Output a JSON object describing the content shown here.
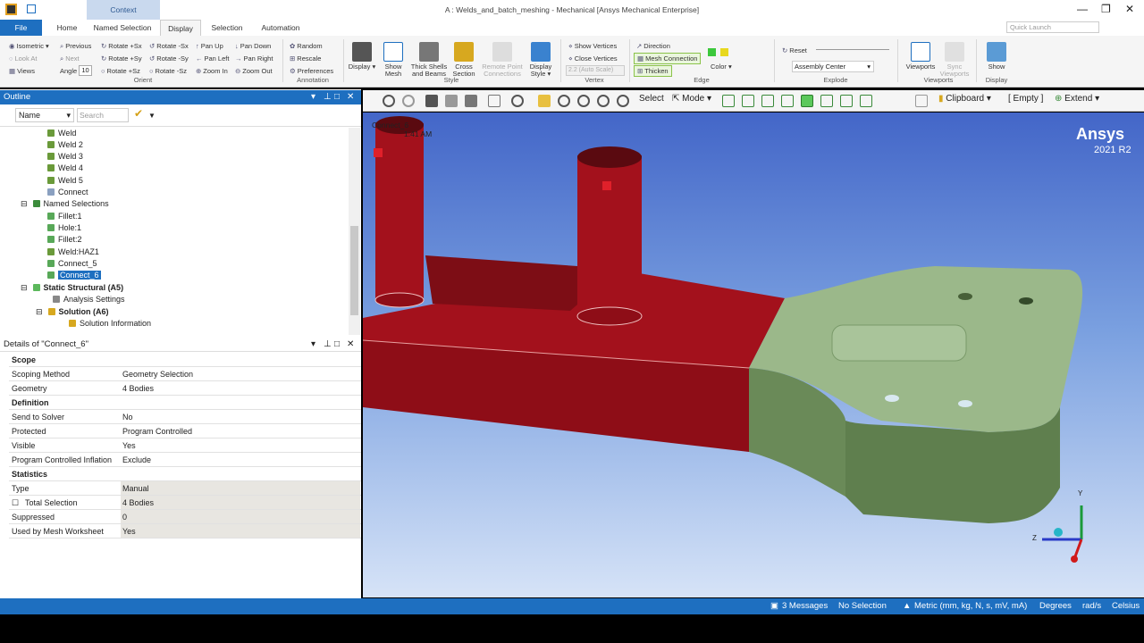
{
  "window": {
    "title": "A : Welds_and_batch_meshing - Mechanical [Ansys Mechanical Enterprise]",
    "context_label": "Context"
  },
  "tabs": [
    "File",
    "Home",
    "Named Selection",
    "Display",
    "Selection",
    "Automation"
  ],
  "quick_launch_placeholder": "Quick Launch",
  "ribbon": {
    "orient": {
      "items": [
        "Isometric",
        "Previous",
        "Rotate +Sx",
        "Rotate -Sx",
        "Pan Up",
        "Pan Down",
        "Look At",
        "Next",
        "Rotate +Sy",
        "Rotate -Sy",
        "Pan Left",
        "Pan Right",
        "Views",
        "Angle",
        "Rotate +Sz",
        "Rotate -Sz",
        "Zoom In",
        "Zoom Out"
      ],
      "angle_value": "10",
      "label": "Orient"
    },
    "annotation": {
      "items": [
        "Random",
        "Rescale",
        "Preferences"
      ],
      "label": "Annotation"
    },
    "style": {
      "items": [
        "Display",
        "Show Mesh",
        "Thick Shells and Beams",
        "Cross Section",
        "Remote Point Connections",
        "Display Style"
      ],
      "label": "Style"
    },
    "vertex": {
      "items": [
        "Show Vertices",
        "Close Vertices"
      ],
      "scale": "2.2 (Auto Scale)",
      "label": "Vertex"
    },
    "edge": {
      "items": [
        "Direction",
        "Mesh Connection",
        "Thicken",
        "Color"
      ],
      "label": "Edge"
    },
    "explode": {
      "reset": "Reset",
      "center": "Assembly Center",
      "label": "Explode"
    },
    "viewports": {
      "items": [
        "Viewports",
        "Sync Viewports"
      ],
      "label": "Viewports"
    },
    "display": {
      "items": [
        "Show"
      ],
      "label": "Display"
    }
  },
  "outline": {
    "title": "Outline",
    "filter_name": "Name",
    "search_placeholder": "Search Outline",
    "items": [
      "Weld",
      "Weld 2",
      "Weld 3",
      "Weld 4",
      "Weld 5",
      "Connect",
      "Named Selections",
      "Fillet:1",
      "Hole:1",
      "Fillet:2",
      "Weld:HAZ1",
      "Connect_5",
      "Connect_6",
      "Static Structural (A5)",
      "Analysis Settings",
      "Solution (A6)",
      "Solution Information"
    ]
  },
  "details": {
    "title": "Details of \"Connect_6\"",
    "rows": [
      {
        "k": "Scope",
        "v": ""
      },
      {
        "k": "Scoping Method",
        "v": "Geometry Selection"
      },
      {
        "k": "Geometry",
        "v": "4 Bodies"
      },
      {
        "k": "Definition",
        "v": ""
      },
      {
        "k": "Send to Solver",
        "v": "No"
      },
      {
        "k": "Protected",
        "v": "Program Controlled"
      },
      {
        "k": "Visible",
        "v": "Yes"
      },
      {
        "k": "Program Controlled Inflation",
        "v": "Exclude"
      },
      {
        "k": "Statistics",
        "v": ""
      },
      {
        "k": "Type",
        "v": "Manual"
      },
      {
        "k": "Total Selection",
        "v": "4 Bodies"
      },
      {
        "k": "Suppressed",
        "v": "0"
      },
      {
        "k": "Used by Mesh Worksheet",
        "v": "Yes"
      }
    ]
  },
  "view_toolbar": {
    "select": "Select",
    "mode": "Mode",
    "clipboard": "Clipboard",
    "empty": "[ Empty ]",
    "extend": "Extend"
  },
  "viewport": {
    "annotation": "Connect_6",
    "time": "1:41 AM",
    "brand": "Ansys",
    "version": "2021 R2",
    "axis_y": "Y",
    "axis_z": "Z"
  },
  "status": {
    "messages": "3 Messages",
    "selection": "No Selection",
    "units": "Metric (mm, kg, N, s, mV, mA)",
    "angle": "Degrees",
    "rate": "rad/s",
    "temp": "Celsius"
  },
  "colors": {
    "accent": "#1e6fc0",
    "red_body": "#a3111c",
    "green_body": "#9bb88a"
  }
}
